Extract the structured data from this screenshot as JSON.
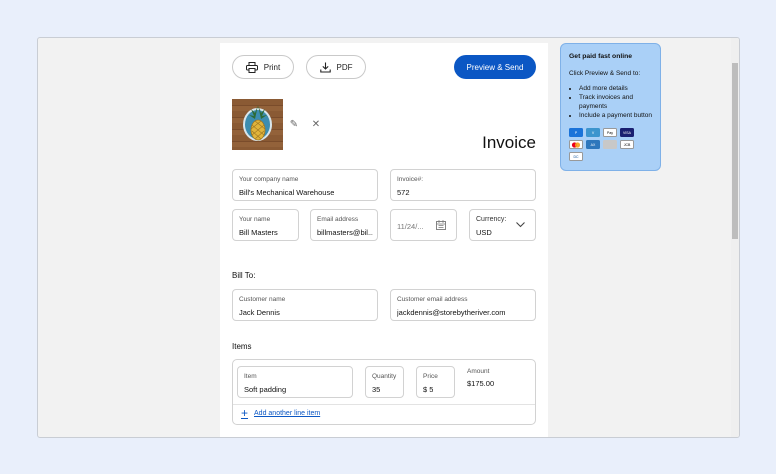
{
  "toolbar": {
    "print_label": "Print",
    "pdf_label": "PDF",
    "preview_send_label": "Preview & Send"
  },
  "invoice": {
    "title": "Invoice"
  },
  "company": {
    "label": "Your company name",
    "value": "Bill's Mechanical Warehouse"
  },
  "invoice_number": {
    "label": "Invoice#:",
    "value": "572"
  },
  "your_name": {
    "label": "Your name",
    "value": "Bill Masters"
  },
  "email": {
    "label": "Email address",
    "value": "billmasters@bil..."
  },
  "date": {
    "value": "11/24/..."
  },
  "currency": {
    "label": "Currency:",
    "value": "USD"
  },
  "bill_to": {
    "heading": "Bill To:",
    "customer_name": {
      "label": "Customer name",
      "value": "Jack Dennis"
    },
    "customer_email": {
      "label": "Customer email address",
      "value": "jackdennis@storebytheriver.com"
    }
  },
  "items": {
    "heading": "Items",
    "row": {
      "item": {
        "label": "Item",
        "value": "Soft padding"
      },
      "quantity": {
        "label": "Quantity",
        "value": "35"
      },
      "price": {
        "label": "Price",
        "value": "$ 5"
      },
      "amount": {
        "label": "Amount",
        "value": "$175.00"
      }
    },
    "add_line_label": "Add another line item"
  },
  "tip": {
    "title": "Get paid fast online",
    "intro": "Click Preview & Send to:",
    "bullets": [
      "Add more details",
      "Track invoices and payments",
      "Include a payment button"
    ],
    "payment_icons": [
      "paypal-icon",
      "venmo-icon",
      "apple-pay-icon",
      "visa-icon",
      "mastercard-icon",
      "amex-icon",
      "bank-icon",
      "jcb-icon",
      "diners-icon"
    ]
  },
  "colors": {
    "accent": "#0b57c4",
    "tip_bg": "#aad0f7",
    "page_bg": "#e9effb"
  }
}
